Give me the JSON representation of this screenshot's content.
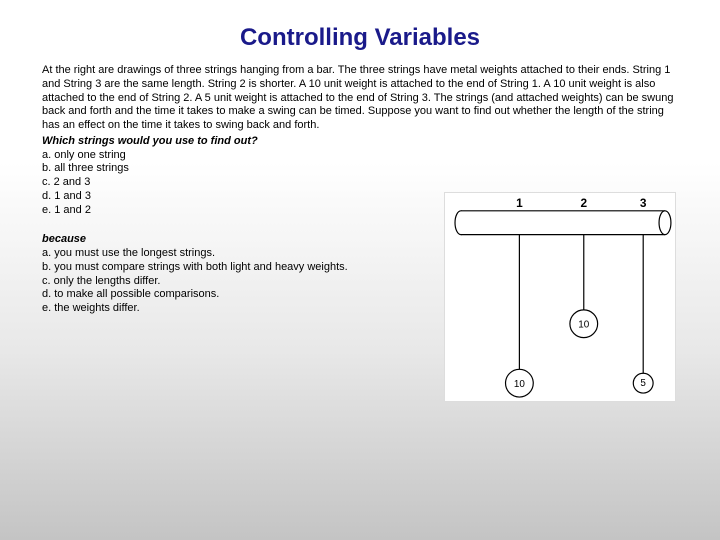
{
  "title": "Controlling Variables",
  "paragraph": "At the right are drawings of three strings hanging from a bar. The three strings have metal weights attached to their ends. String 1 and String 3 are the same length. String 2 is shorter. A 10 unit weight is attached to the end of String 1. A 10 unit weight is also attached to the end of String 2. A 5 unit weight is attached to the end of String 3. The strings (and attached weights) can be swung back and forth and the time it takes to make a swing can be timed. Suppose you want to find out whether the length of the string has an effect on the time it takes to swing back and forth.",
  "question": "Which strings would you use to find out?",
  "options_a": {
    "a": "a. only one string",
    "b": "b. all three strings",
    "c": "c. 2 and 3",
    "d": "d. 1 and 3",
    "e": "e. 1 and 2"
  },
  "because_label": "because",
  "options_b": {
    "a": "a. you must use the longest strings.",
    "b": "b. you must compare strings with both light and heavy weights.",
    "c": "c. only the lengths differ.",
    "d": "d. to make all possible comparisons.",
    "e": "e. the weights differ."
  },
  "diagram": {
    "labels": {
      "s1": "1",
      "s2": "2",
      "s3": "3"
    },
    "weights": {
      "s1": "10",
      "s2": "10",
      "s3": "5"
    }
  }
}
